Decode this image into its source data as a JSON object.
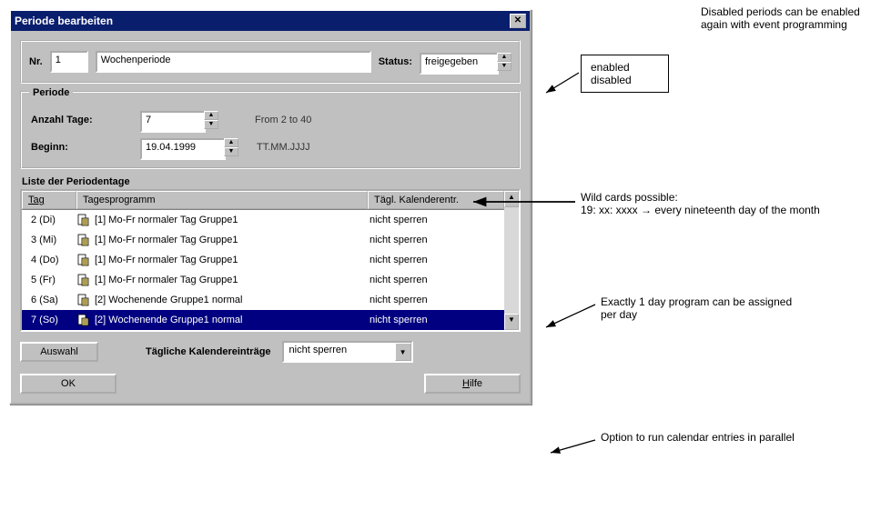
{
  "dialog": {
    "title": "Periode bearbeiten",
    "nr_label": "Nr.",
    "nr_value": "1",
    "name_value": "Wochenperiode",
    "status_label": "Status:",
    "status_value": "freigegeben"
  },
  "periode": {
    "legend": "Periode",
    "anzahl_label": "Anzahl Tage:",
    "anzahl_value": "7",
    "anzahl_hint": "From 2 to 40",
    "beginn_label": "Beginn:",
    "beginn_value": "19.04.1999",
    "beginn_hint": "TT.MM.JJJJ"
  },
  "list": {
    "title": "Liste der Periodentage",
    "headers": {
      "tag": "Tag",
      "prog": "Tagesprogramm",
      "kal": "Tägl. Kalenderentr."
    },
    "rows": [
      {
        "tag": "2 (Di)",
        "prog": "[1]  Mo-Fr normaler Tag Gruppe1",
        "kal": "nicht sperren",
        "sel": false
      },
      {
        "tag": "3 (Mi)",
        "prog": "[1]  Mo-Fr normaler Tag Gruppe1",
        "kal": "nicht sperren",
        "sel": false
      },
      {
        "tag": "4 (Do)",
        "prog": "[1]  Mo-Fr normaler Tag Gruppe1",
        "kal": "nicht sperren",
        "sel": false
      },
      {
        "tag": "5 (Fr)",
        "prog": "[1]  Mo-Fr normaler Tag Gruppe1",
        "kal": "nicht sperren",
        "sel": false
      },
      {
        "tag": "6 (Sa)",
        "prog": "[2]  Wochenende Gruppe1 normal",
        "kal": "nicht sperren",
        "sel": false
      },
      {
        "tag": "7 (So)",
        "prog": "[2]  Wochenende Gruppe1 normal",
        "kal": "nicht sperren",
        "sel": true
      }
    ]
  },
  "bottom": {
    "auswahl": "Auswahl",
    "taegl_label": "Tägliche Kalendereinträge",
    "taegl_value": "nicht sperren",
    "ok": "OK",
    "hilfe": "Hilfe"
  },
  "annotations": {
    "enabled_box_l1": "enabled",
    "enabled_box_l2": "disabled",
    "a1": "Disabled periods can be enabled again with event programming",
    "a2": "Wild cards possible:\n19: xx: xxxx → every nineteenth day of the month",
    "a3": "Exactly 1 day program can be assigned per day",
    "a4": "Option to run calendar entries in parallel"
  }
}
